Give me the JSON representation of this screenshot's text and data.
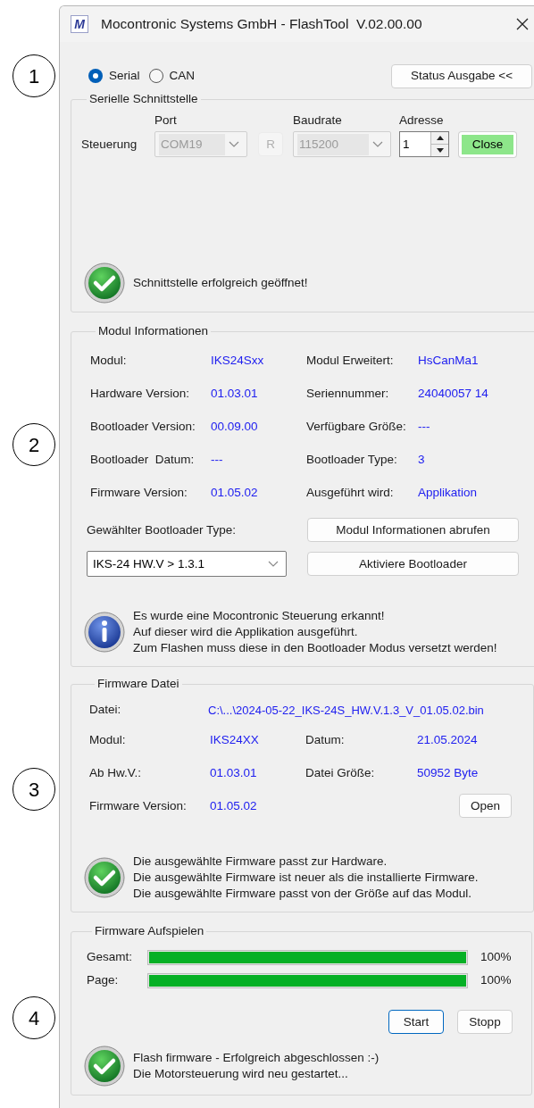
{
  "annotations": [
    {
      "label": "1"
    },
    {
      "label": "2"
    },
    {
      "label": "3"
    },
    {
      "label": "4"
    }
  ],
  "window": {
    "icon_letter": "M",
    "title": "Mocontronic Systems GmbH - FlashTool  V.02.00.00"
  },
  "connection": [
    {
      "label": "Serial",
      "selected": true
    },
    {
      "label": "CAN",
      "selected": false
    }
  ],
  "status_button": "Status Ausgabe <<",
  "serial_group": {
    "title": "Serielle Schnittstelle",
    "columns": [
      "Port",
      "Baudrate",
      "Adresse"
    ],
    "row_label": "Steuerung",
    "port": {
      "value": "COM19",
      "disabled": true
    },
    "refresh_button": {
      "label": "R",
      "disabled": true
    },
    "baudrate": {
      "value": "115200",
      "disabled": true
    },
    "address": "1",
    "connect_button": "Close",
    "status": {
      "kind": "success",
      "lines": [
        "Schnittstelle erfolgreich geöffnet!"
      ]
    }
  },
  "module_group": {
    "title": "Modul Informationen",
    "rows": [
      [
        {
          "label": "Modul:",
          "value": "IKS24Sxx"
        },
        {
          "label": "Modul Erweitert:",
          "value": "HsCanMa1"
        }
      ],
      [
        {
          "label": "Hardware Version:",
          "value": "01.03.01"
        },
        {
          "label": "Seriennummer:",
          "value": "24040057 14"
        }
      ],
      [
        {
          "label": "Bootloader Version:",
          "value": "00.09.00"
        },
        {
          "label": "Verfügbare Größe:",
          "value": "---"
        }
      ],
      [
        {
          "label": "Bootloader  Datum:",
          "value": "---"
        },
        {
          "label": "Bootloader Type:",
          "value": "3"
        }
      ],
      [
        {
          "label": "Firmware Version:",
          "value": "01.05.02"
        },
        {
          "label": "Ausgeführt wird:",
          "value": "Applikation"
        }
      ]
    ],
    "bootloader_type_label": "Gewählter Bootloader Type:",
    "bootloader_type": "IKS-24 HW.V > 1.3.1",
    "buttons": [
      "Modul Informationen abrufen",
      "Aktiviere Bootloader"
    ],
    "status": {
      "kind": "info",
      "lines": [
        "Es wurde eine Mocontronic Steuerung erkannt!",
        "Auf dieser wird die Applikation ausgeführt.",
        "Zum Flashen muss diese in den Bootloader Modus versetzt werden!"
      ]
    }
  },
  "firmware_group": {
    "title": "Firmware Datei",
    "file": {
      "label": "Datei:",
      "value": "C:\\...\\2024-05-22_IKS-24S_HW.V.1.3_V_01.05.02.bin"
    },
    "rows": [
      [
        {
          "label": "Modul:",
          "value": "IKS24XX"
        },
        {
          "label": "Datum:",
          "value": "21.05.2024"
        }
      ],
      [
        {
          "label": "Ab Hw.V.:",
          "value": "01.03.01"
        },
        {
          "label": "Datei Größe:",
          "value": "50952 Byte"
        }
      ],
      [
        {
          "label": "Firmware Version:",
          "value": "01.05.02"
        }
      ]
    ],
    "open_button": "Open",
    "status": {
      "kind": "success",
      "lines": [
        "Die ausgewählte Firmware passt zur Hardware.",
        "Die ausgewählte Firmware ist neuer als die installierte Firmware.",
        "Die ausgewählte Firmware passt von der Größe auf das Modul."
      ]
    }
  },
  "flash_group": {
    "title": "Firmware Aufspielen",
    "progress": [
      {
        "label": "Gesamt:",
        "level": 1,
        "reading": "100%"
      },
      {
        "label": "Page:",
        "level": 1,
        "reading": "100%"
      }
    ],
    "buttons": [
      {
        "label": "Start",
        "focused": true
      },
      {
        "label": "Stopp",
        "focused": false
      }
    ],
    "status": {
      "kind": "success",
      "lines": [
        "Flash firmware - Erfolgreich abgeschlossen :-)",
        "Die Motorsteuerung wird neu gestartet..."
      ]
    }
  }
}
